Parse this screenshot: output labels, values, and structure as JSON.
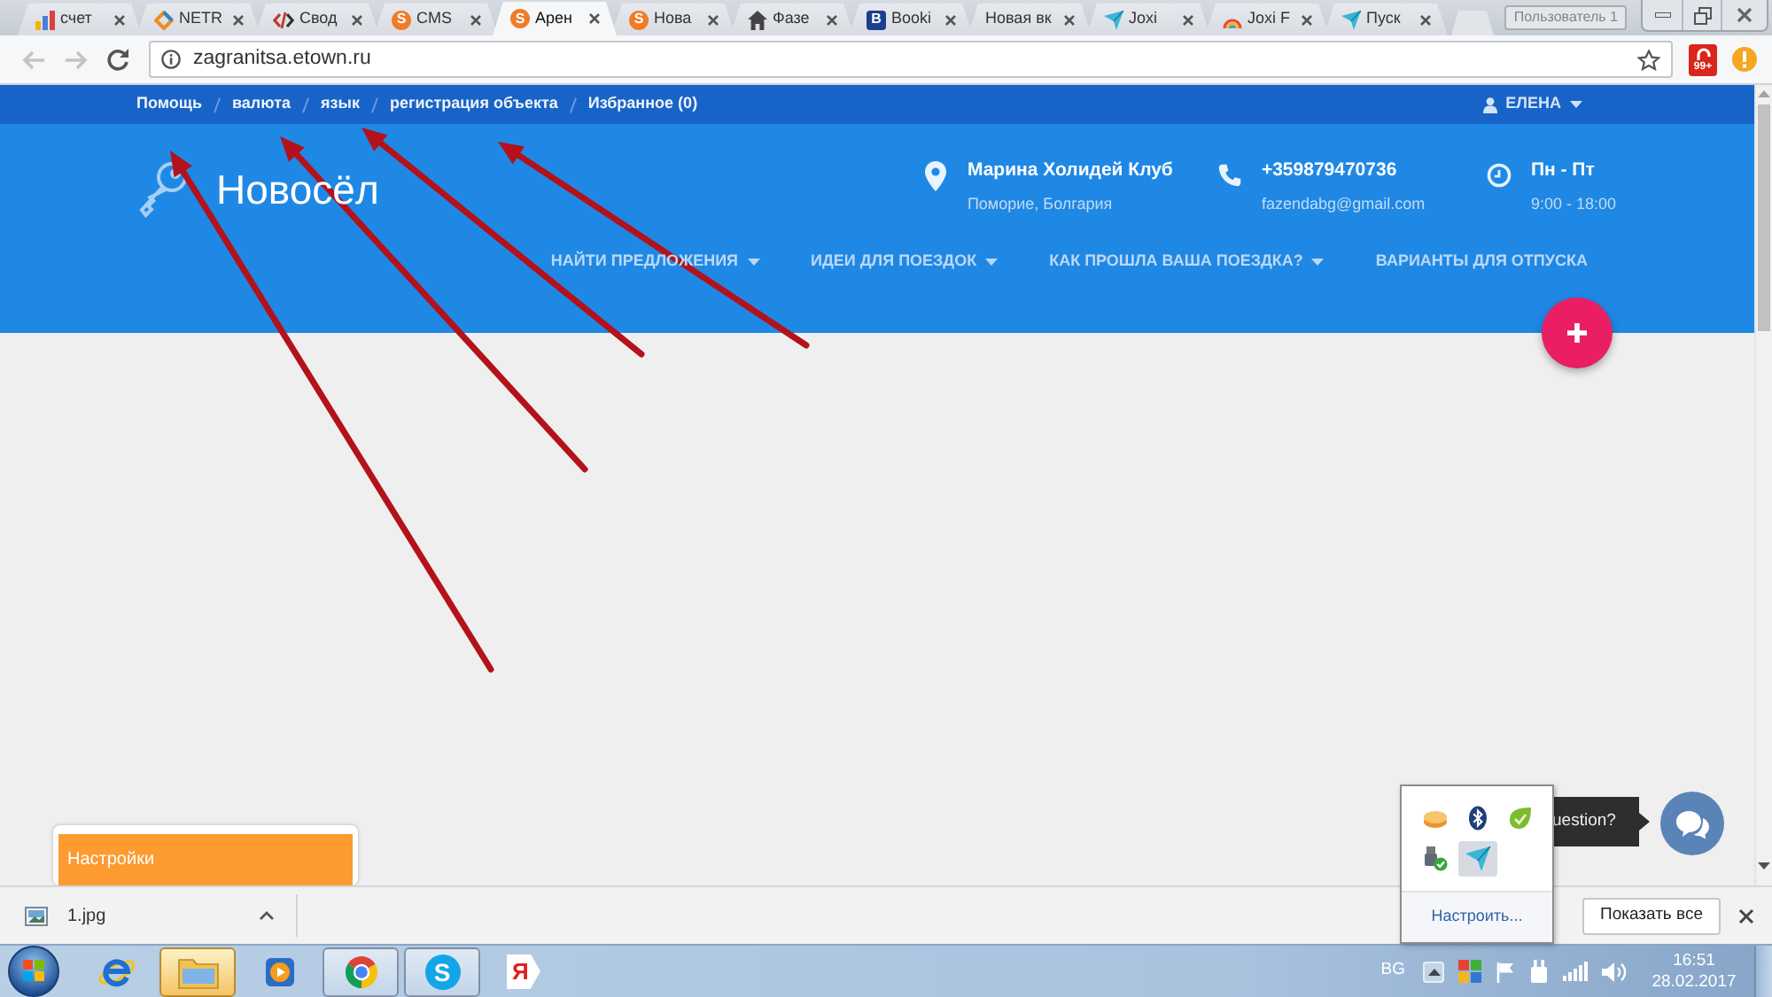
{
  "browser": {
    "tabs": [
      {
        "title": "счет",
        "kind": "bars",
        "selected": false
      },
      {
        "title": "NETR",
        "kind": "diamond",
        "selected": false
      },
      {
        "title": "Свод",
        "kind": "code",
        "selected": false
      },
      {
        "title": "CMS",
        "kind": "coin",
        "letter": "S",
        "selected": false
      },
      {
        "title": "Арен",
        "kind": "coin",
        "letter": "S",
        "selected": true
      },
      {
        "title": "Нова",
        "kind": "coin",
        "letter": "S",
        "selected": false
      },
      {
        "title": "Фазе",
        "kind": "house",
        "selected": false
      },
      {
        "title": "Booki",
        "kind": "letter",
        "letter": "B",
        "selected": false
      },
      {
        "title": "Новая вк",
        "kind": "none",
        "selected": false
      },
      {
        "title": "Joxi",
        "kind": "bird",
        "selected": false
      },
      {
        "title": "Joxi F",
        "kind": "rainbow",
        "selected": false
      },
      {
        "title": "Пуск",
        "kind": "bird",
        "selected": false
      }
    ],
    "profile": "Пользователь 1",
    "back_disabled": true,
    "forward_disabled": true,
    "url": "zagranitsa.etown.ru",
    "extension_badge": "99+"
  },
  "site": {
    "top_links": [
      "Помощь",
      "валюта",
      "язык",
      "регистрация объекта",
      "Избранное (0)"
    ],
    "user": "ЕЛЕНА",
    "logo": "Новосёл",
    "contacts": [
      {
        "kind": "pin",
        "title": "Марина Холидей Клуб",
        "subtitle": "Поморие, Болгария"
      },
      {
        "kind": "phone",
        "title": "+359879470736",
        "subtitle": "fazendabg@gmail.com"
      },
      {
        "kind": "clock",
        "title": "Пн - Пт",
        "subtitle": "9:00 - 18:00"
      }
    ],
    "menu": [
      {
        "label": "НАЙТИ ПРЕДЛОЖЕНИЯ",
        "dropdown": true
      },
      {
        "label": "ИДЕИ ДЛЯ ПОЕЗДОК",
        "dropdown": true
      },
      {
        "label": "КАК ПРОШЛА ВАША ПОЕЗДКА?",
        "dropdown": true
      },
      {
        "label": "ВАРИАНТЫ ДЛЯ ОТПУСКА",
        "dropdown": false
      }
    ],
    "settings_widget": "Настройки",
    "chat_tooltip": "uestion?"
  },
  "downloads": {
    "file": "1.jpg",
    "show_all": "Показать все"
  },
  "tray_popup": {
    "icons": [
      {
        "kind": "discs",
        "selected": false
      },
      {
        "kind": "bluetooth",
        "selected": false
      },
      {
        "kind": "leaf",
        "selected": false
      },
      {
        "kind": "usb",
        "selected": false
      },
      {
        "kind": "bird",
        "selected": true
      }
    ],
    "customize": "Настроить..."
  },
  "taskbar": {
    "apps": [
      {
        "kind": "ie",
        "running": false,
        "highlighted": false
      },
      {
        "kind": "explorer",
        "running": true,
        "highlighted": true
      },
      {
        "kind": "media",
        "running": false,
        "highlighted": false
      },
      {
        "kind": "chrome",
        "running": true,
        "highlighted": false
      },
      {
        "kind": "skype",
        "letter": "S",
        "running": true,
        "highlighted": false
      },
      {
        "kind": "yandex",
        "letter": "Я",
        "running": false,
        "highlighted": false
      }
    ],
    "language": "BG",
    "tray": [
      {
        "kind": "tiles"
      },
      {
        "kind": "flag"
      },
      {
        "kind": "plug"
      },
      {
        "kind": "signal"
      },
      {
        "kind": "speaker"
      }
    ],
    "time": "16:51",
    "date": "28.02.2017"
  }
}
